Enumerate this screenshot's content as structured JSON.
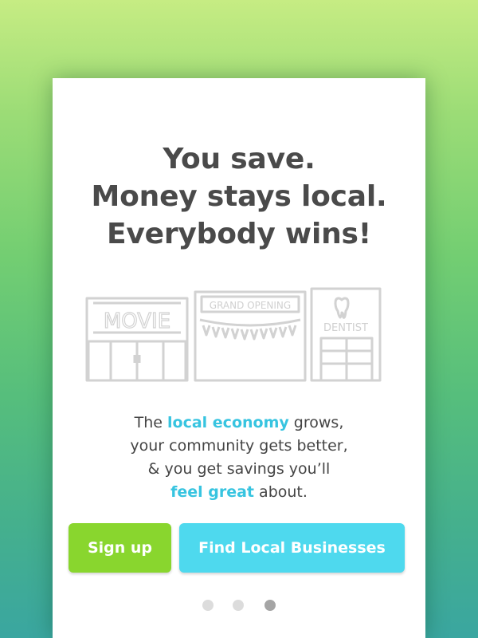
{
  "colors": {
    "headline": "#4a4a4a",
    "highlight": "#37c4e0",
    "signup_button": "#89d62e",
    "find_button": "#4ed9ee",
    "illustration_stroke": "#d2d2d2",
    "dot_inactive": "#dcdcdc",
    "dot_active": "#a5a5a5"
  },
  "headline": {
    "line1": "You save.",
    "line2": "Money stays local.",
    "line3": "Everybody wins!"
  },
  "illustration": {
    "movie_sign": "MOVIE",
    "grand_opening_banner": "GRAND OPENING",
    "dentist_sign": "DENTIST",
    "dentist_icon": "tooth-icon"
  },
  "body": {
    "l1_pre": "The ",
    "l1_highlight": "local economy",
    "l1_post": " grows,",
    "l2": "your community gets better,",
    "l3": "& you get savings you’ll",
    "l4_highlight": "feel great",
    "l4_post": " about."
  },
  "buttons": {
    "signup": "Sign up",
    "find": "Find Local Businesses"
  },
  "pagination": {
    "total": 3,
    "active": 3
  }
}
